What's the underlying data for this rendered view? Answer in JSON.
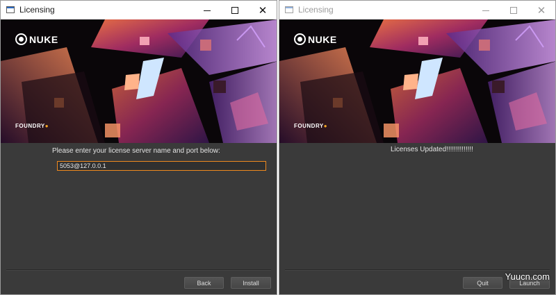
{
  "windows": [
    {
      "title": "Licensing",
      "product_logo": "NUKE",
      "company": "FOUNDRY",
      "prompt": "Please enter your license server name and port below:",
      "server_value": "5053@127.0.0.1",
      "buttons": {
        "back": "Back",
        "install": "Install"
      }
    },
    {
      "title": "Licensing",
      "product_logo": "NUKE",
      "company": "FOUNDRY",
      "message": "Licenses Updated!!!!!!!!!!!!!!",
      "buttons": {
        "quit": "Quit",
        "launch": "Launch"
      }
    }
  ],
  "watermark": "Yuucn.com",
  "colors": {
    "panel_bg": "#3a3a3a",
    "input_focus_border": "#f08a1e",
    "foundry_dot": "#f5a623"
  },
  "icons": [
    "app-window-icon",
    "minimize-icon",
    "maximize-icon",
    "close-icon",
    "nuke-logo-icon"
  ]
}
